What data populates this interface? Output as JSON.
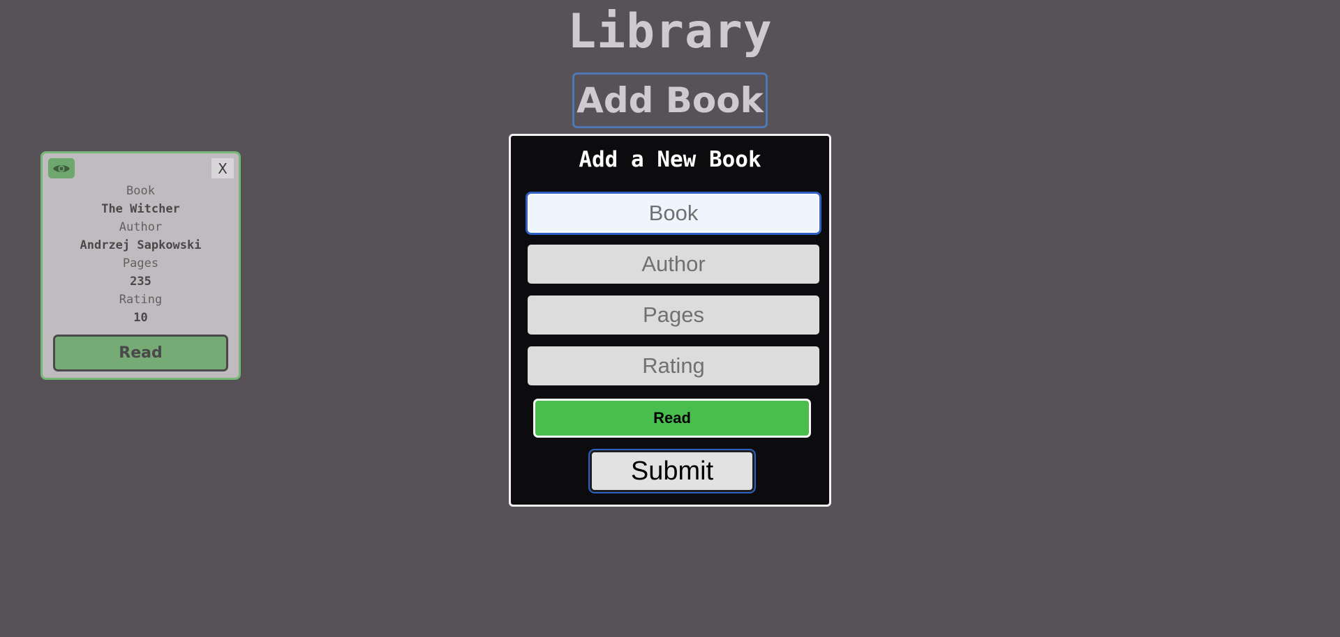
{
  "header": {
    "title": "Library",
    "add_book_label": "Add Book"
  },
  "book_card": {
    "toggle_icon": "eye-icon",
    "close_label": "X",
    "fields": [
      {
        "label": "Book",
        "value": "The Witcher"
      },
      {
        "label": "Author",
        "value": "Andrzej Sapkowski"
      },
      {
        "label": "Pages",
        "value": "235"
      },
      {
        "label": "Rating",
        "value": "10"
      }
    ],
    "read_label": "Read",
    "accent_color": "#76b776"
  },
  "form": {
    "title": "Add a New Book",
    "book_placeholder": "Book",
    "book_value": "",
    "author_placeholder": "Author",
    "pages_placeholder": "Pages",
    "rating_placeholder": "Rating",
    "read_label": "Read",
    "submit_label": "Submit",
    "read_color": "#49bd4e"
  }
}
